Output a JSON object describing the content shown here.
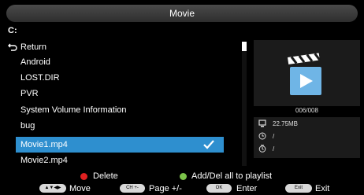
{
  "window": {
    "title": "Movie"
  },
  "path": "C:",
  "list": {
    "items": [
      {
        "label": "Return"
      },
      {
        "label": "Android"
      },
      {
        "label": "LOST.DIR"
      },
      {
        "label": "PVR"
      },
      {
        "label": "System Volume Information"
      },
      {
        "label": "bug"
      },
      {
        "label": "Movie1.mp4",
        "selected": true
      },
      {
        "label": "Movie2.mp4"
      }
    ]
  },
  "preview": {
    "counter": "006/008"
  },
  "info": {
    "size": "22.75MB",
    "duration": "/",
    "date": "/"
  },
  "hints": {
    "delete": "Delete",
    "playlist": "Add/Del all to playlist",
    "nav_key": "▲▼◀▶",
    "nav_label": "Move",
    "page_key": "CH +-",
    "page_label": "Page +/-",
    "ok_key": "OK",
    "ok_label": "Enter",
    "exit_key": "Exit",
    "exit_label": "Exit"
  },
  "colors": {
    "accent": "#2e8fcf",
    "red": "#e02020",
    "green": "#7cc34a"
  }
}
